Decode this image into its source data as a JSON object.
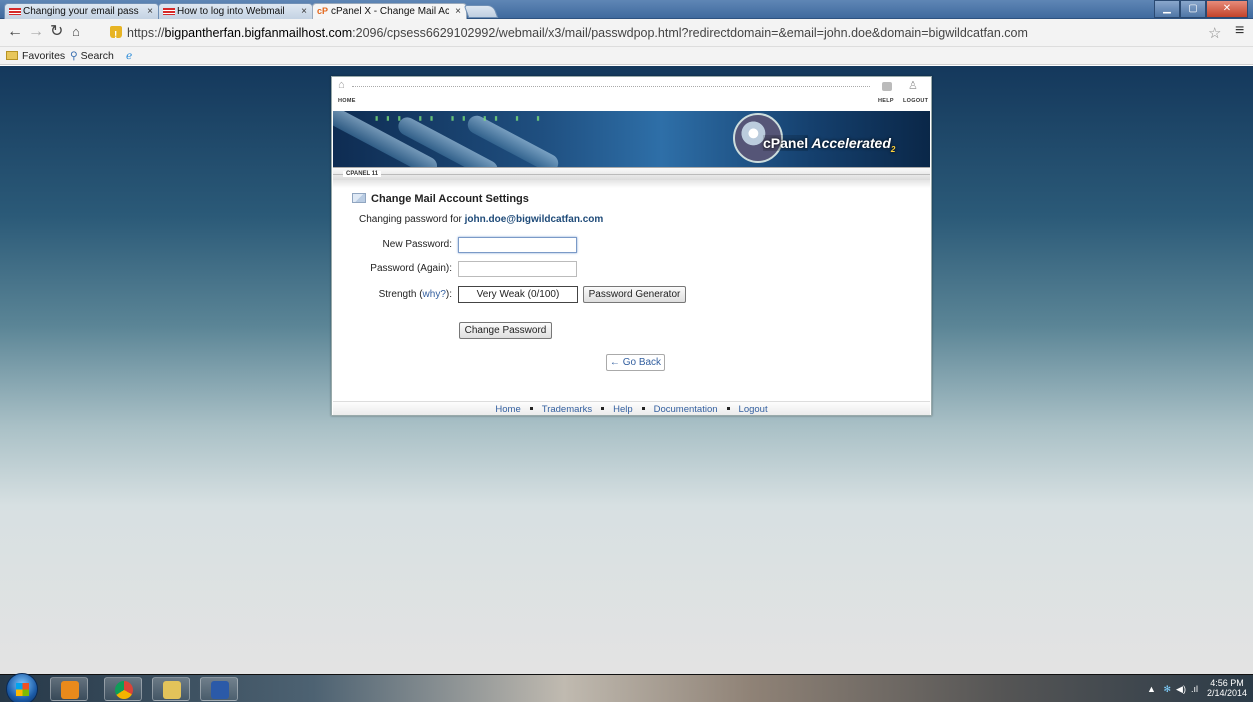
{
  "browser": {
    "tabs": [
      {
        "label": "Changing your email pass",
        "icon": "bigfan-icon"
      },
      {
        "label": "How to log into Webmail",
        "icon": "bigfan-icon"
      },
      {
        "label": "cPanel X - Change Mail Ac",
        "icon": "cpanel-icon",
        "active": true
      }
    ],
    "tab_close": "×",
    "url_prefix": "https://",
    "url_host": "bigpantherfan.bigfanmailhost.com",
    "url_rest": ":2096/cpsess6629102992/webmail/x3/mail/passwdpop.html?redirectdomain=&email=john.doe&domain=bigwildcatfan.com",
    "bookmarks": [
      {
        "label": "Favorites",
        "icon": "folder-icon"
      },
      {
        "label": "Search",
        "icon": "search-icon"
      }
    ]
  },
  "cpanel": {
    "home_label": "HOME",
    "help_label": "HELP",
    "logout_label": "LOGOUT",
    "brand": "cPanel",
    "brand_suffix": "Accelerated",
    "brand_sub": "2",
    "version_label": "CPANEL 11",
    "heading": "Change Mail Account Settings",
    "subline_prefix": "Changing password for",
    "account": "john.doe@bigwildcatfan.com",
    "form": {
      "new_password_label": "New Password:",
      "new_password_value": "",
      "password_again_label": "Password (Again):",
      "password_again_value": "",
      "strength_label": "Strength (",
      "strength_why": "why?",
      "strength_suffix": "):",
      "strength_value": "Very Weak (0/100)",
      "generator_button": "Password Generator",
      "change_button": "Change Password",
      "go_back": "← Go Back"
    },
    "footer_links": [
      "Home",
      "Trademarks",
      "Help",
      "Documentation",
      "Logout"
    ]
  },
  "taskbar": {
    "clock_time": "4:56 PM",
    "clock_date": "2/14/2014"
  },
  "colors": {
    "link": "#3460a0",
    "account": "#1e4a78",
    "brand_accent": "#ffd23a"
  }
}
